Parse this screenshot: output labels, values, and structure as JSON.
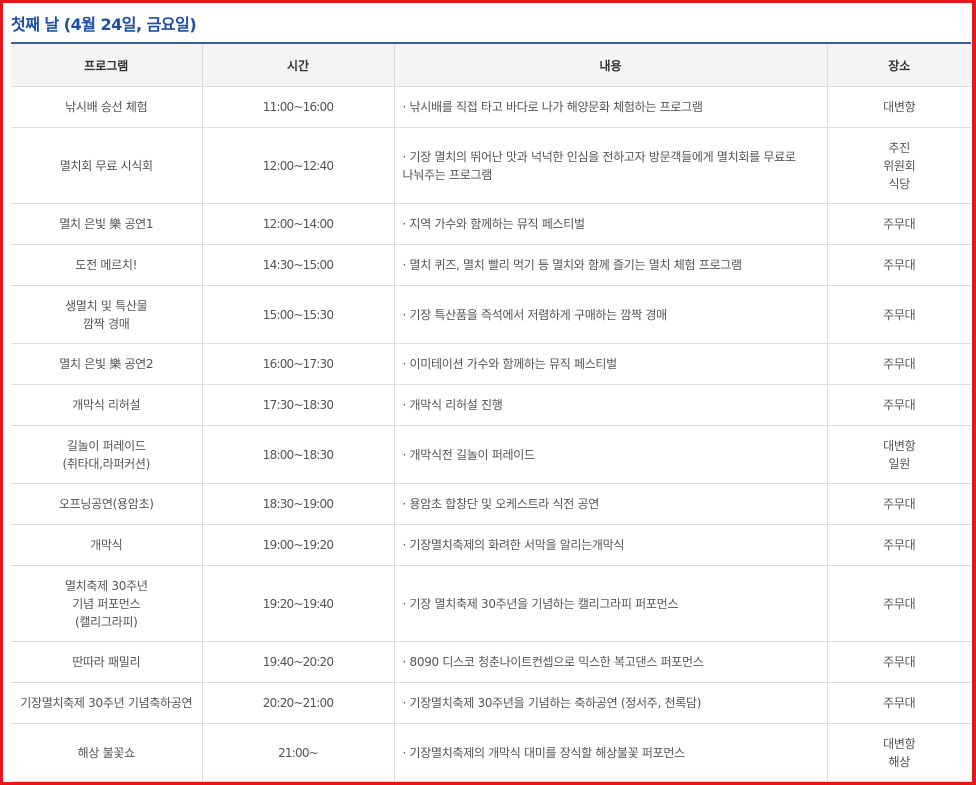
{
  "title": "첫째 날 (4월 24일, 금요일)",
  "headers": {
    "program": "프로그램",
    "time": "시간",
    "content": "내용",
    "place": "장소"
  },
  "rows": [
    {
      "program": "낚시배 승선 체험",
      "time": "11:00~16:00",
      "content": "· 낚시배를 직접 타고 바다로 나가 해양문화 체험하는 프로그램",
      "place": "대변항"
    },
    {
      "program": "멸치회 무료 시식회",
      "time": "12:00~12:40",
      "content": "· 기장 멸치의 뛰어난 맛과 넉넉한 인심을 전하고자 방문객들에게 멸치회를  무료로\n나눠주는 프로그램",
      "place": "추진\n위원회\n식당"
    },
    {
      "program": "멸치 은빛 樂 공연1",
      "time": "12:00~14:00",
      "content": "· 지역 가수와 함께하는 뮤직 페스티벌",
      "place": "주무대"
    },
    {
      "program": "도전 메르치!",
      "time": "14:30~15:00",
      "content": "· 멸치 퀴즈, 멸치 빨리 먹기 등 멸치와 함께 즐기는 멸치 체험 프로그램",
      "place": "주무대"
    },
    {
      "program": "생멸치 및 특산물\n깜짝 경매",
      "time": "15:00~15:30",
      "content": "· 기장 특산품을 즉석에서 저렴하게 구매하는 깜짝 경매",
      "place": "주무대"
    },
    {
      "program": "멸치 은빛 樂 공연2",
      "time": "16:00~17:30",
      "content": "· 이미테이션 가수와 함께하는 뮤직 페스티벌",
      "place": "주무대"
    },
    {
      "program": "개막식 리허설",
      "time": "17:30~18:30",
      "content": "· 개막식 리허설 진행",
      "place": "주무대"
    },
    {
      "program": "길놀이 퍼레이드\n(취타대,라퍼커션)",
      "time": "18:00~18:30",
      "content": "· 개막식전 길놀이 퍼레이드",
      "place": "대변항\n일원"
    },
    {
      "program": "오프닝공연(용암초)",
      "time": "18:30~19:00",
      "content": "· 용암초 합창단 및 오케스트라 식전 공연",
      "place": "주무대"
    },
    {
      "program": "개막식",
      "time": "19:00~19:20",
      "content": "· 기장멸치축제의 화려한 서막을 알리는개막식",
      "place": "주무대"
    },
    {
      "program": "멸치축제 30주년\n기념 퍼포먼스\n(캘리그라피)",
      "time": "19:20~19:40",
      "content": "· 기장 멸치축제 30주년을 기념하는 캘리그라피 퍼포먼스",
      "place": "주무대"
    },
    {
      "program": "딴따라 패밀리",
      "time": "19:40~20:20",
      "content": "· 8090 디스코 청춘나이트컨셉으로 믹스한 복고댄스 퍼포먼스",
      "place": "주무대"
    },
    {
      "program": "기장멸치축제 30주년 기념축하공연",
      "time": "20:20~21:00",
      "content": "· 기장멸치축제 30주년을 기념하는 축하공연 (정서주, 천록담)",
      "place": "주무대"
    },
    {
      "program": "해상 불꽃쇼",
      "time": "21:00~",
      "content": "· 기장멸치축제의 개막식 대미를 장식할 해상불꽃 퍼포먼스",
      "place": "대변항\n해상"
    }
  ]
}
